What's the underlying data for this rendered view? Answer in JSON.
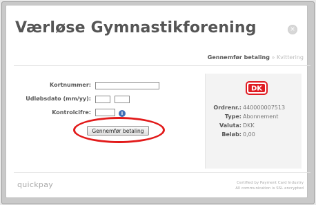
{
  "header": {
    "title": "Værløse Gymnastikforening",
    "close_symbol": "×"
  },
  "steps": {
    "active": "Gennemfør betaling",
    "separator": "»",
    "next": "Kvittering"
  },
  "form": {
    "card_number_label": "Kortnummer:",
    "card_number_value": "",
    "expiry_label": "Udløbsdato (mm/yy):",
    "expiry_month_value": "",
    "expiry_year_value": "",
    "cvc_label": "Kontrolcifre:",
    "cvc_value": "",
    "info_symbol": "i",
    "submit_label": "Gennemfør betaling"
  },
  "order": {
    "logo_text": "DK",
    "logo_color": "#e01b22",
    "order_no_label": "Ordrenr.:",
    "order_no_value": "440000007513",
    "type_label": "Type:",
    "type_value": "Abonnement",
    "currency_label": "Valuta:",
    "currency_value": "DKK",
    "amount_label": "Beløb:",
    "amount_value": "0,00"
  },
  "footer": {
    "brand": "quickpay",
    "cert_line1": "Certified by Payment Card Industry",
    "cert_line2": "All communication is SSL encrypted"
  },
  "colors": {
    "highlight": "#e21a1a",
    "info_icon": "#3f6fb8"
  }
}
